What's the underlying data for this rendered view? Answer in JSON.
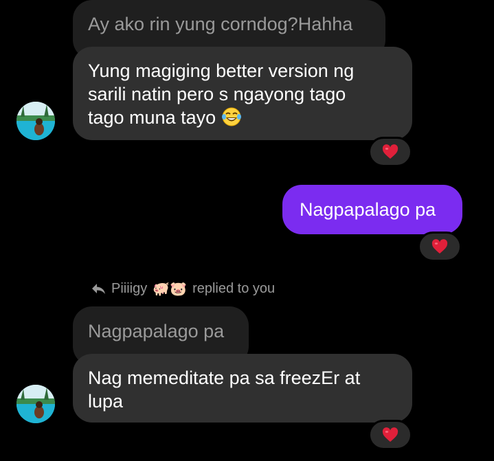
{
  "messages": [
    {
      "quoted_text": "Ay ako rin yung corndog?Hahha",
      "text": "Yung magiging better version ng sarili natin pero s ngayong tago tago muna tayo",
      "line1": "Yung magiging better version ng",
      "line2": "sarili natin pero s ngayong tago",
      "line3": "tago muna tayo",
      "emoji": "face-with-tears-of-joy",
      "reaction": "red-heart"
    },
    {
      "text": "Nagpapalago pa",
      "reaction": "red-heart"
    },
    {
      "reply_sender": "Piiiigy",
      "reply_emojis": "🐖🐷",
      "reply_label": "replied to you",
      "quoted_text": "Nagpapalago pa",
      "line1": "Nag memeditate pa sa freezEr at",
      "line2": "lupa",
      "reaction": "red-heart"
    }
  ],
  "colors": {
    "background": "#000000",
    "incoming_bubble": "#303030",
    "quoted_bubble": "#1f1f1f",
    "outgoing_bubble": "#7b2cf0",
    "heart": "#e0203a"
  }
}
